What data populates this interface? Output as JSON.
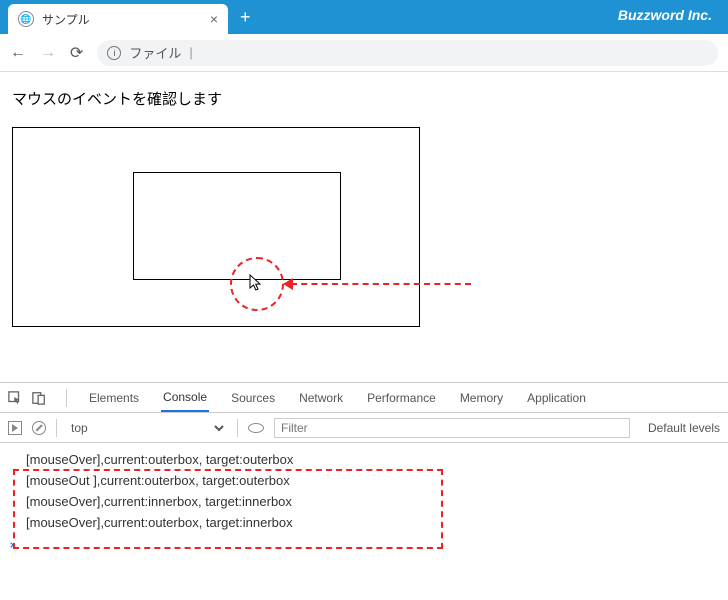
{
  "browser": {
    "tab_title": "サンプル",
    "brand": "Buzzword Inc.",
    "url_label": "ファイル",
    "url_prefix": "|"
  },
  "page": {
    "heading": "マウスのイベントを確認します"
  },
  "devtools": {
    "tabs": {
      "elements": "Elements",
      "console": "Console",
      "sources": "Sources",
      "network": "Network",
      "performance": "Performance",
      "memory": "Memory",
      "application": "Application"
    },
    "toolbar": {
      "context": "top",
      "filter_placeholder": "Filter",
      "levels_label": "Default levels"
    },
    "logs": [
      "[mouseOver],current:outerbox, target:outerbox",
      "[mouseOut ],current:outerbox, target:outerbox",
      "[mouseOver],current:innerbox, target:innerbox",
      "[mouseOver],current:outerbox, target:innerbox"
    ]
  }
}
